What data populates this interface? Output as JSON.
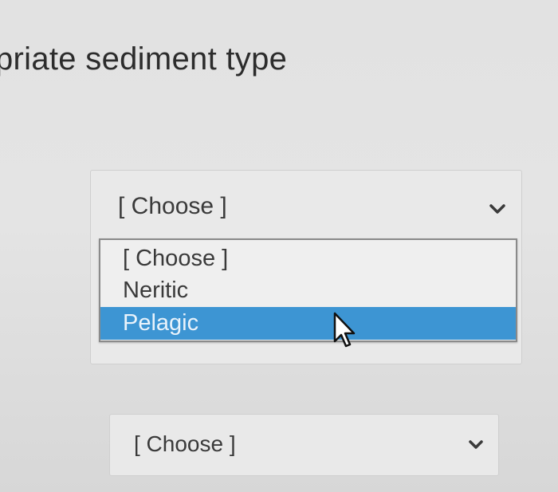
{
  "question": {
    "heading": "priate sediment type"
  },
  "select_1": {
    "selected": "[ Choose ]",
    "options": [
      "[ Choose ]",
      "Neritic",
      "Pelagic"
    ],
    "highlighted_option": "Pelagic"
  },
  "select_2": {
    "selected": "[ Choose ]"
  },
  "icons": {
    "dropdown_chevron": "chevron-down-icon",
    "pointer": "mouse-pointer-icon"
  },
  "colors": {
    "highlight": "#3d95d3",
    "highlight_text": "#eaf3fb"
  }
}
